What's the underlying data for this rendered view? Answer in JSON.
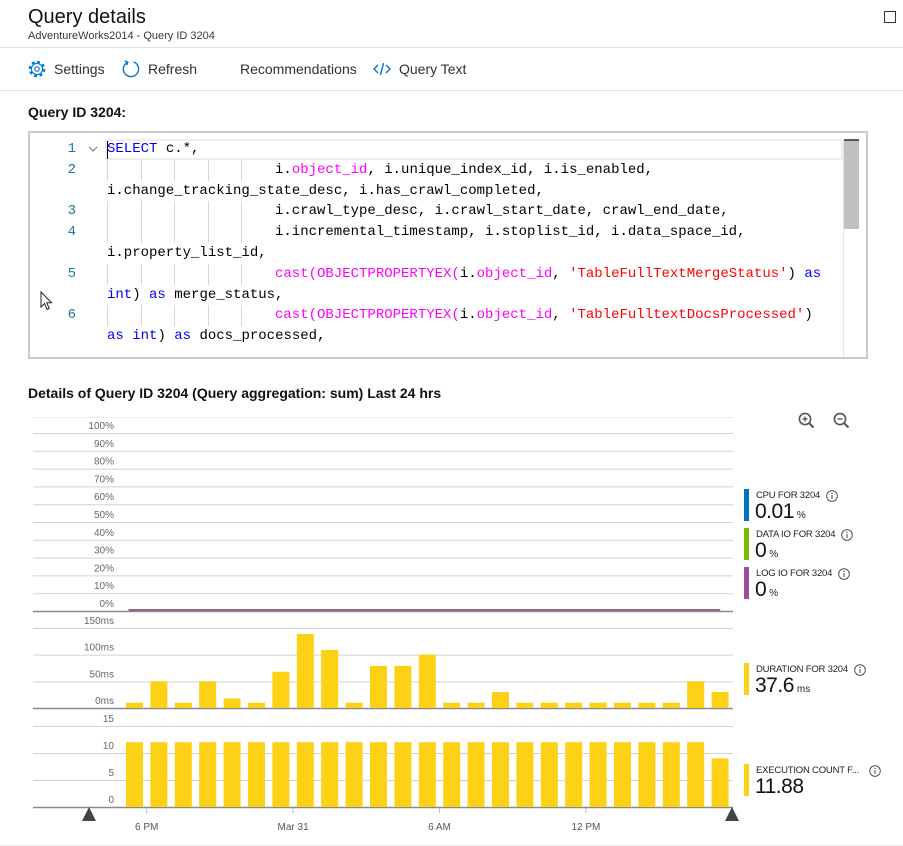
{
  "header": {
    "title": "Query details",
    "subtitle": "AdventureWorks2014 - Query ID 3204"
  },
  "toolbar": {
    "items": [
      {
        "label": "Settings",
        "icon": "gear-icon"
      },
      {
        "label": "Refresh",
        "icon": "refresh-icon"
      },
      {
        "label": "Recommendations",
        "icon": null
      },
      {
        "label": "Query Text",
        "icon": "code-icon"
      }
    ]
  },
  "query": {
    "heading": "Query ID 3204:"
  },
  "editor": {
    "cursor_line": 1,
    "syntax": {
      "keyword": "#0000ff",
      "function": "#ff00ff",
      "string": "#ff0000",
      "text": "#000000"
    },
    "lines": [
      {
        "num": "1",
        "fold": true,
        "indent": 0,
        "rows": [
          [
            [
              "keyword",
              "SELECT"
            ],
            [
              "text",
              " c.*,"
            ]
          ]
        ]
      },
      {
        "num": "2",
        "fold": false,
        "indent": 20,
        "rows": [
          [
            [
              "text",
              "i."
            ],
            [
              "function",
              "object_id"
            ],
            [
              "text",
              ", i.unique_index_id, i.is_enabled,"
            ]
          ],
          [
            [
              "text",
              "i.change_tracking_state_desc, i.has_crawl_completed,"
            ]
          ]
        ]
      },
      {
        "num": "3",
        "fold": false,
        "indent": 20,
        "rows": [
          [
            [
              "text",
              "i.crawl_type_desc, i.crawl_start_date, crawl_end_date,"
            ]
          ]
        ]
      },
      {
        "num": "4",
        "fold": false,
        "indent": 20,
        "rows": [
          [
            [
              "text",
              "i.incremental_timestamp, i.stoplist_id, i.data_space_id,"
            ]
          ],
          [
            [
              "text",
              "i.property_list_id,"
            ]
          ]
        ]
      },
      {
        "num": "5",
        "fold": false,
        "indent": 20,
        "rows": [
          [
            [
              "function",
              "cast(OBJECTPROPERTYEX("
            ],
            [
              "text",
              "i."
            ],
            [
              "function",
              "object_id"
            ],
            [
              "text",
              ", "
            ],
            [
              "string",
              "'TableFullTextMergeStatus'"
            ],
            [
              "text",
              ") "
            ],
            [
              "keyword",
              "as"
            ]
          ],
          [
            [
              "keyword",
              "int"
            ],
            [
              "text",
              ") "
            ],
            [
              "keyword",
              "as"
            ],
            [
              "text",
              " merge_status,"
            ]
          ]
        ]
      },
      {
        "num": "6",
        "fold": false,
        "indent": 20,
        "rows": [
          [
            [
              "function",
              "cast(OBJECTPROPERTYEX("
            ],
            [
              "text",
              "i."
            ],
            [
              "function",
              "object_id"
            ],
            [
              "text",
              ", "
            ],
            [
              "string",
              "'TableFulltextDocsProcessed'"
            ],
            [
              "text",
              ")"
            ]
          ],
          [
            [
              "keyword",
              "as"
            ],
            [
              "text",
              " "
            ],
            [
              "keyword",
              "int"
            ],
            [
              "text",
              ") "
            ],
            [
              "keyword",
              "as"
            ],
            [
              "text",
              " docs_processed,"
            ]
          ]
        ]
      }
    ]
  },
  "details": {
    "heading": "Details of Query ID 3204 (Query aggregation: sum) Last 24 hrs"
  },
  "legend": [
    {
      "label": "CPU FOR 3204",
      "value": "0.01",
      "unit": "%",
      "color": "#0072c6"
    },
    {
      "label": "DATA IO FOR 3204",
      "value": "0",
      "unit": "%",
      "color": "#7fba00"
    },
    {
      "label": "LOG IO FOR 3204",
      "value": "0",
      "unit": "%",
      "color": "#9b4f96"
    },
    {
      "label": "DURATION FOR 3204",
      "value": "37.6",
      "unit": "ms",
      "color": "#fcd116"
    },
    {
      "label": "EXECUTION COUNT F...",
      "value": "11.88",
      "unit": "",
      "color": "#fcd116"
    }
  ],
  "chart_data": [
    {
      "panel": "resource",
      "type": "line",
      "title": "Details of Query ID 3204 (Query aggregation: sum) Last 24 hrs",
      "ylim": [
        0,
        100
      ],
      "y_ticks": [
        {
          "value": 0,
          "label": "0%"
        },
        {
          "value": 10,
          "label": "10%"
        },
        {
          "value": 20,
          "label": "20%"
        },
        {
          "value": 30,
          "label": "30%"
        },
        {
          "value": 40,
          "label": "40%"
        },
        {
          "value": 50,
          "label": "50%"
        },
        {
          "value": 60,
          "label": "60%"
        },
        {
          "value": 70,
          "label": "70%"
        },
        {
          "value": 80,
          "label": "80%"
        },
        {
          "value": 90,
          "label": "90%"
        },
        {
          "value": 100,
          "label": "100%"
        }
      ],
      "series": [
        {
          "key": "cpu",
          "name": "CPU FOR 3204",
          "color": "#0072c6",
          "values": [
            0,
            0,
            0,
            0,
            0,
            0,
            0,
            0,
            0,
            0,
            0,
            0,
            0,
            0,
            0,
            0,
            0,
            0,
            0,
            0,
            0,
            0,
            0,
            0,
            0
          ]
        },
        {
          "key": "data-io",
          "name": "DATA IO FOR 3204",
          "color": "#7fba00",
          "values": [
            0,
            0,
            0,
            0,
            0,
            0,
            0,
            0,
            0,
            0,
            0,
            0,
            0,
            0,
            0,
            0,
            0,
            0,
            0,
            0,
            0,
            0,
            0,
            0,
            0
          ]
        },
        {
          "key": "log-io",
          "name": "LOG IO FOR 3204",
          "color": "#9b4f96",
          "values": [
            0,
            0,
            0,
            0,
            0,
            0,
            0,
            0,
            0,
            0,
            0,
            0,
            0,
            0,
            0,
            0,
            0,
            0,
            0,
            0,
            0,
            0,
            0,
            0,
            0
          ]
        }
      ]
    },
    {
      "panel": "duration",
      "type": "bar",
      "ylim": [
        0,
        150
      ],
      "y_ticks": [
        {
          "value": 0,
          "label": "0ms"
        },
        {
          "value": 50,
          "label": "50ms"
        },
        {
          "value": 100,
          "label": "100ms"
        },
        {
          "value": 150,
          "label": "150ms"
        }
      ],
      "series": [
        {
          "name": "DURATION FOR 3204",
          "unit": "ms",
          "color": "#fcd116",
          "values": [
            10,
            50,
            10,
            50,
            18,
            10,
            68,
            139,
            109,
            10,
            79,
            79,
            100,
            10,
            10,
            30,
            10,
            10,
            10,
            10,
            10,
            10,
            10,
            50,
            30
          ]
        }
      ]
    },
    {
      "panel": "execution-count",
      "type": "bar",
      "ylim": [
        0,
        15
      ],
      "y_ticks": [
        {
          "value": 0,
          "label": "0"
        },
        {
          "value": 5,
          "label": "5"
        },
        {
          "value": 10,
          "label": "10"
        },
        {
          "value": 15,
          "label": "15"
        }
      ],
      "series": [
        {
          "name": "EXECUTION COUNT F...",
          "color": "#fcd116",
          "values": [
            12,
            12,
            12,
            12,
            12,
            12,
            12,
            12,
            12,
            12,
            12,
            12,
            12,
            12,
            12,
            12,
            12,
            12,
            12,
            12,
            12,
            12,
            12,
            12,
            9
          ]
        }
      ],
      "x_ticks": [
        {
          "label": "6 PM",
          "at": 0.5
        },
        {
          "label": "Mar 31",
          "at": 6.5
        },
        {
          "label": "6 AM",
          "at": 12.5
        },
        {
          "label": "12 PM",
          "at": 18.5
        }
      ]
    }
  ]
}
